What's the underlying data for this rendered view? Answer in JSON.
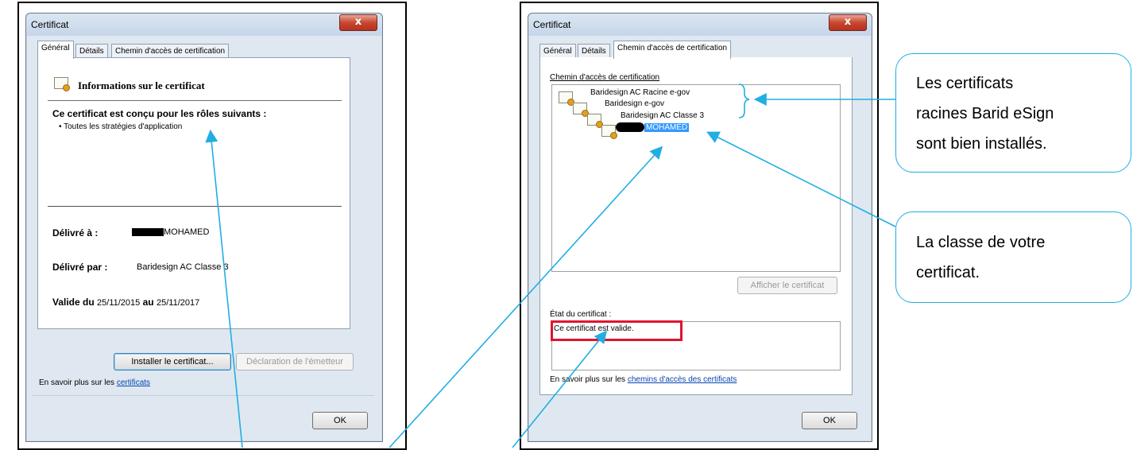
{
  "left_dialog": {
    "title": "Certificat",
    "close": "x",
    "tabs": [
      "Général",
      "Détails",
      "Chemin d'accès de certification"
    ],
    "info_title": "Informations sur le certificat",
    "roles_heading": "Ce certificat est conçu pour les rôles suivants :",
    "roles_item": "• Toutes les stratégies d'application",
    "issued_to_label": "Délivré à :",
    "issued_to_value": "MOHAMED",
    "issued_by_label": "Délivré par :",
    "issued_by_value": "Baridesign AC Classe 3",
    "valid_from_label": "Valide du",
    "valid_from_value": "25/11/2015",
    "valid_to_label": "au",
    "valid_to_value": "25/11/2017",
    "install_button": "Installer le certificat...",
    "issuer_button": "Déclaration de l'émetteur",
    "learn_more_text": "En savoir plus sur les",
    "learn_more_link": "certificats",
    "ok_button": "OK"
  },
  "right_dialog": {
    "title": "Certificat",
    "close": "x",
    "tabs": [
      "Général",
      "Détails",
      "Chemin d'accès de certification"
    ],
    "path_group_label": "Chemin d'accès de certification",
    "tree": [
      "Baridesign AC Racine e-gov",
      "Baridesign e-gov",
      "Baridesign AC Classe 3",
      "MOHAMED"
    ],
    "view_button": "Afficher le certificat",
    "status_label": "État du certificat :",
    "status_text": "Ce certificat est valide.",
    "learn_more_text": "En savoir plus sur les",
    "learn_more_link": "chemins d'accès des certificats",
    "ok_button": "OK"
  },
  "callouts": {
    "roots": [
      "Les certificats",
      "racines Barid eSign",
      "sont bien installés."
    ],
    "class": [
      "La classe de votre",
      "certificat."
    ]
  },
  "colors": {
    "callout": "#21aee3",
    "highlight": "#e0142e",
    "selection": "#3399ff"
  }
}
